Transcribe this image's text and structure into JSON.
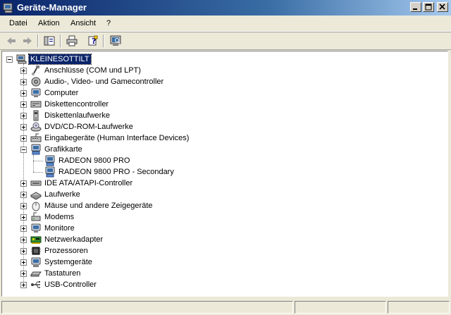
{
  "window": {
    "title": "Geräte-Manager"
  },
  "menu": [
    {
      "label": "Datei"
    },
    {
      "label": "Aktion"
    },
    {
      "label": "Ansicht"
    },
    {
      "label": "?"
    }
  ],
  "toolbar": {
    "icons": [
      "back-arrow-icon",
      "forward-arrow-icon",
      "console-tree-icon",
      "print-icon",
      "help-properties-icon",
      "scan-hardware-icon"
    ]
  },
  "tree": {
    "root": {
      "label": "KLEINESOTTILT",
      "icon": "computer-icon"
    },
    "categories": [
      {
        "label": "Anschlüsse (COM und LPT)",
        "icon": "port-icon"
      },
      {
        "label": "Audio-, Video- und Gamecontroller",
        "icon": "speaker-icon"
      },
      {
        "label": "Computer",
        "icon": "monitor-icon"
      },
      {
        "label": "Diskettencontroller",
        "icon": "disk-controller-icon"
      },
      {
        "label": "Diskettenlaufwerke",
        "icon": "floppy-drive-icon"
      },
      {
        "label": "DVD/CD-ROM-Laufwerke",
        "icon": "cdrom-icon"
      },
      {
        "label": "Eingabegeräte (Human Interface Devices)",
        "icon": "hid-icon"
      },
      {
        "label": "Grafikkarte",
        "icon": "display-adapter-icon",
        "expanded": true,
        "children": [
          {
            "label": "RADEON 9800 PRO",
            "icon": "display-adapter-icon"
          },
          {
            "label": "RADEON 9800 PRO - Secondary",
            "icon": "display-adapter-icon"
          }
        ]
      },
      {
        "label": "IDE ATA/ATAPI-Controller",
        "icon": "ide-controller-icon"
      },
      {
        "label": "Laufwerke",
        "icon": "hard-drive-icon"
      },
      {
        "label": "Mäuse und andere Zeigegeräte",
        "icon": "mouse-icon"
      },
      {
        "label": "Modems",
        "icon": "modem-icon"
      },
      {
        "label": "Monitore",
        "icon": "monitor-icon"
      },
      {
        "label": "Netzwerkadapter",
        "icon": "network-adapter-icon"
      },
      {
        "label": "Prozessoren",
        "icon": "processor-icon"
      },
      {
        "label": "Systemgeräte",
        "icon": "system-device-icon"
      },
      {
        "label": "Tastaturen",
        "icon": "keyboard-icon"
      },
      {
        "label": "USB-Controller",
        "icon": "usb-icon"
      }
    ]
  },
  "colors": {
    "titlebar_start": "#0a246a",
    "titlebar_end": "#a6caf0",
    "selection": "#0a246a",
    "chrome": "#ece9d8"
  }
}
